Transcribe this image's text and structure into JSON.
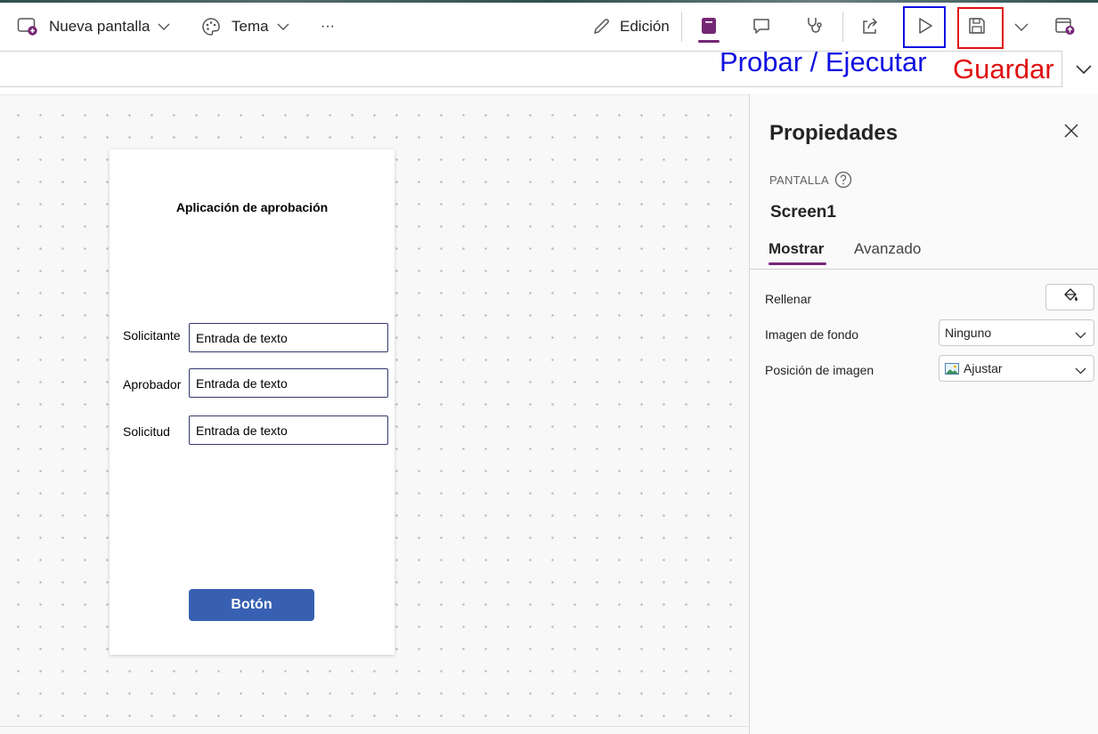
{
  "toolbar": {
    "new_screen_label": "Nueva pantalla",
    "theme_label": "Tema",
    "more_label": "···",
    "edit_label": "Edición",
    "accent_color": "#742774"
  },
  "annotations": {
    "run_label": "Probar / Ejecutar",
    "save_label": "Guardar",
    "run_color": "#1010e0",
    "save_color": "#e01010"
  },
  "app_screen": {
    "title": "Aplicación de aprobación",
    "fields": [
      {
        "label": "Solicitante",
        "value": "Entrada de texto"
      },
      {
        "label": "Aprobador",
        "value": "Entrada de texto"
      },
      {
        "label": "Solicitud",
        "value": "Entrada de texto"
      }
    ],
    "button_label": "Botón",
    "button_color": "#3860b2"
  },
  "properties_panel": {
    "title": "Propiedades",
    "section": "PANTALLA",
    "screen_name": "Screen1",
    "tabs": [
      {
        "label": "Mostrar",
        "active": true
      },
      {
        "label": "Avanzado",
        "active": false
      }
    ],
    "props": {
      "fill_label": "Rellenar",
      "bg_image_label": "Imagen de fondo",
      "bg_image_value": "Ninguno",
      "image_position_label": "Posición de imagen",
      "image_position_value": "Ajustar"
    }
  }
}
